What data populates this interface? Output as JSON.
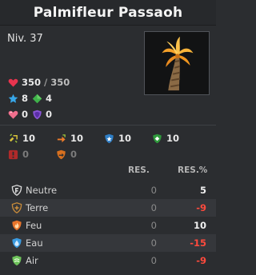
{
  "monster": {
    "name": "Palmifleur Passaoh",
    "level": "Niv. 37",
    "portrait": "palm-tree-creature"
  },
  "stats": {
    "health_current": "350",
    "health_max": "350",
    "ap": "8",
    "mp": "4",
    "heart_pink": "0",
    "shield_purple": "0"
  },
  "secondary": {
    "row1": [
      {
        "icon": "lock-dodge-icon",
        "value": "10"
      },
      {
        "icon": "push-damage-icon",
        "value": "10"
      },
      {
        "icon": "ap-resist-shield-icon",
        "value": "10"
      },
      {
        "icon": "mp-resist-shield-icon",
        "value": "10"
      }
    ],
    "row2": [
      {
        "icon": "critical-resist-icon",
        "value": "0"
      },
      {
        "icon": "push-resist-icon",
        "value": "0"
      }
    ]
  },
  "resistances": {
    "header_res": "RES.",
    "header_pct": "RES.%",
    "rows": [
      {
        "icon": "neutral-icon",
        "name": "Neutre",
        "res": "0",
        "pct": "5",
        "color": "#d9d9d9"
      },
      {
        "icon": "earth-icon",
        "name": "Terre",
        "res": "0",
        "pct": "-9",
        "color": "#c58a3b"
      },
      {
        "icon": "fire-icon",
        "name": "Feu",
        "res": "0",
        "pct": "10",
        "color": "#e8742b"
      },
      {
        "icon": "water-icon",
        "name": "Eau",
        "res": "0",
        "pct": "-15",
        "color": "#3b9be0"
      },
      {
        "icon": "air-icon",
        "name": "Air",
        "res": "0",
        "pct": "-9",
        "color": "#6dc25a"
      }
    ]
  },
  "colors": {
    "negative": "#ff4a3d",
    "health": "#e8344e",
    "ap": "#37a6e8",
    "mp": "#3fb24a"
  }
}
